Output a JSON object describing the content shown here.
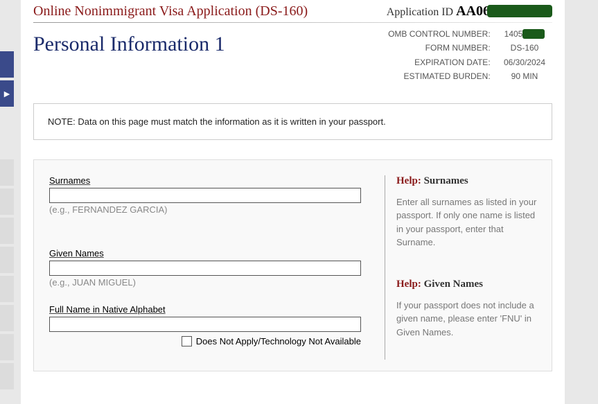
{
  "header": {
    "app_title": "Online Nonimmigrant Visa Application (DS-160)",
    "app_id_label": "Application ID",
    "app_id_value_visible": "AA06"
  },
  "meta": {
    "omb_label": "OMB CONTROL NUMBER:",
    "omb_value": "1405",
    "form_label": "FORM NUMBER:",
    "form_value": "DS-160",
    "exp_label": "EXPIRATION DATE:",
    "exp_value": "06/30/2024",
    "burden_label": "ESTIMATED BURDEN:",
    "burden_value": "90 MIN"
  },
  "section_title": "Personal Information 1",
  "note": "NOTE: Data on this page must match the information as it is written in your passport.",
  "fields": {
    "surnames_label": "Surnames",
    "surnames_hint": "(e.g., FERNANDEZ GARCIA)",
    "given_label": "Given Names",
    "given_hint": "(e.g., JUAN MIGUEL)",
    "native_label": "Full Name in Native Alphabet",
    "na_checkbox_label": "Does Not Apply/Technology Not Available"
  },
  "help": {
    "label": "Help:",
    "surnames_topic": " Surnames",
    "surnames_text": "Enter all surnames as listed in your passport. If only one name is listed in your passport, enter that Surname.",
    "given_topic": " Given Names",
    "given_text": "If your passport does not include a given name, please enter 'FNU' in Given Names."
  }
}
